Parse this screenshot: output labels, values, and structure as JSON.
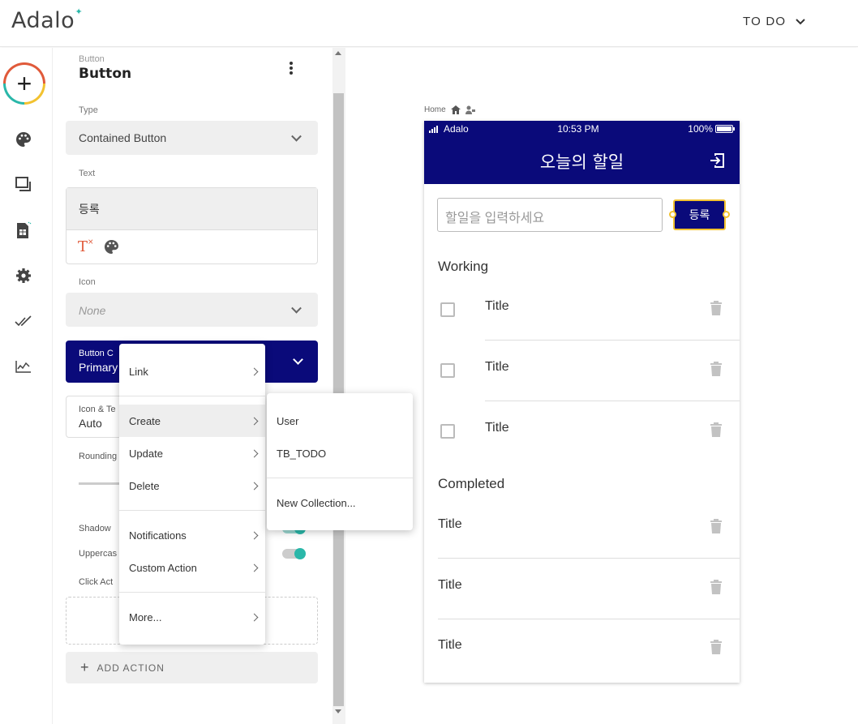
{
  "topbar": {
    "logo": "Adalo",
    "project_name": "TO DO"
  },
  "rail": {
    "icons": [
      "add-icon",
      "palette-icon",
      "screens-icon",
      "database-icon",
      "gear-icon",
      "publish-icon",
      "analytics-icon"
    ]
  },
  "panel": {
    "component_kind": "Button",
    "component_name": "Button",
    "type_label": "Type",
    "type_value": "Contained Button",
    "text_label": "Text",
    "text_value": "등록",
    "icon_label": "Icon",
    "icon_value": "None",
    "button_color_label": "Button C",
    "button_color_value": "Primary",
    "icon_text_label": "Icon & Te",
    "icon_text_value": "Auto",
    "rounding_label": "Rounding",
    "shadow_label": "Shadow",
    "uppercase_label": "Uppercas",
    "click_actions_label": "Click Act",
    "add_action_label": "ADD ACTION"
  },
  "action_menu": {
    "items": [
      {
        "label": "Link"
      },
      {
        "label": "Create"
      },
      {
        "label": "Update"
      },
      {
        "label": "Delete"
      },
      {
        "label": "Notifications"
      },
      {
        "label": "Custom Action"
      },
      {
        "label": "More..."
      }
    ]
  },
  "create_submenu": {
    "items": [
      {
        "label": "User"
      },
      {
        "label": "TB_TODO"
      },
      {
        "label": "New Collection..."
      }
    ]
  },
  "canvas": {
    "breadcrumb": "Home",
    "status": {
      "carrier": "Adalo",
      "time": "10:53 PM",
      "battery": "100%"
    },
    "app_title": "오늘의 할일",
    "input_placeholder": "할일을 입력하세요",
    "register_button": "등록",
    "working_label": "Working",
    "working_items": [
      {
        "title": "Title"
      },
      {
        "title": "Title"
      },
      {
        "title": "Title"
      }
    ],
    "completed_label": "Completed",
    "completed_items": [
      {
        "title": "Title"
      },
      {
        "title": "Title"
      },
      {
        "title": "Title"
      }
    ]
  },
  "colors": {
    "primary": "#0a0a7a",
    "accent": "#2ab7a9",
    "selection": "#f2c230"
  }
}
